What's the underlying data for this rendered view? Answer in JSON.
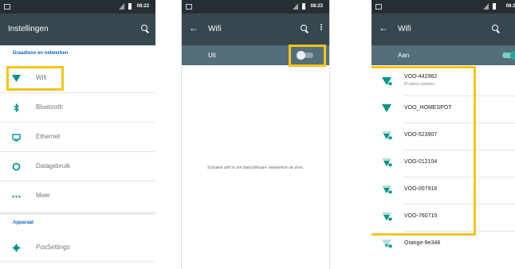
{
  "status_bar": {
    "time": "08:23"
  },
  "screen1": {
    "title": "Instellingen",
    "section_wireless": "Draadloos en netwerken",
    "items": [
      {
        "label": "Wifi",
        "icon": "wifi-icon"
      },
      {
        "label": "Bluetooth",
        "icon": "bluetooth-icon"
      },
      {
        "label": "Ethernet",
        "icon": "ethernet-icon"
      },
      {
        "label": "Datagebruik",
        "icon": "data-usage-icon"
      },
      {
        "label": "Meer",
        "icon": "more-icon"
      }
    ],
    "section_device": "Apparaat",
    "device_items": [
      {
        "label": "PosSettings",
        "icon": "gear-icon"
      }
    ]
  },
  "screen2": {
    "title": "Wifi",
    "switch_label": "Uit",
    "switch_on": false,
    "empty_message": "Schakel wifi in om beschikbare netwerken te zien."
  },
  "screen3": {
    "title": "Wifi",
    "switch_label": "Aan",
    "switch_on": true,
    "networks": [
      {
        "ssid": "VOO-442962",
        "status": "IP-adres ophalen..."
      },
      {
        "ssid": "VOO_HOMESPOT",
        "status": ""
      },
      {
        "ssid": "VOO-523907",
        "status": ""
      },
      {
        "ssid": "VOO-012104",
        "status": ""
      },
      {
        "ssid": "VOO-007916",
        "status": ""
      },
      {
        "ssid": "VOO-760715",
        "status": ""
      },
      {
        "ssid": "Orange-9e348",
        "status": ""
      }
    ]
  },
  "colors": {
    "statusbar": "#262e33",
    "toolbar": "#37474f",
    "switchbar": "#546e7a",
    "accent": "#009688",
    "section_text": "#1565c0",
    "highlight": "#f5c518"
  }
}
